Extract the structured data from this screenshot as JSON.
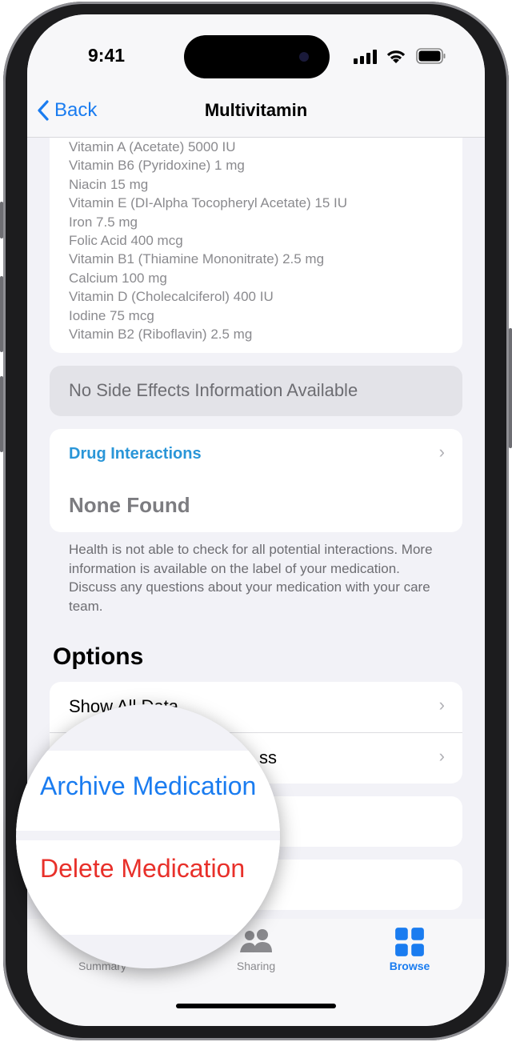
{
  "status_bar": {
    "time": "9:41"
  },
  "nav": {
    "back_label": "Back",
    "title": "Multivitamin"
  },
  "ingredients": [
    "Vitamin A (Acetate) 5000 IU",
    "Vitamin B6 (Pyridoxine) 1 mg",
    "Niacin 15 mg",
    "Vitamin E (DI-Alpha Tocopheryl Acetate) 15 IU",
    "Iron 7.5 mg",
    "Folic Acid 400 mcg",
    "Vitamin B1 (Thiamine Mononitrate) 2.5 mg",
    "Calcium 100 mg",
    "Vitamin D (Cholecalciferol) 400 IU",
    "Iodine 75 mcg",
    "Vitamin B2 (Riboflavin) 2.5 mg"
  ],
  "side_effects": "No Side Effects Information Available",
  "drug_interactions": {
    "title": "Drug Interactions",
    "value": "None Found",
    "note": "Health is not able to check for all potential interactions. More information is available on the label of your medication. Discuss any questions about your medication with your care team."
  },
  "options": {
    "heading": "Options",
    "rows": [
      {
        "label": "Show All Data"
      },
      {
        "label": "ss"
      }
    ]
  },
  "magnifier": {
    "archive": "Archive Medication",
    "delete": "Delete Medication"
  },
  "tabs": [
    {
      "label": "Summary",
      "icon": "heart"
    },
    {
      "label": "Sharing",
      "icon": "people"
    },
    {
      "label": "Browse",
      "icon": "grid",
      "active": true
    }
  ],
  "colors": {
    "accent": "#1a7cf0",
    "destructive": "#e8302a",
    "link": "#2a96d8"
  }
}
